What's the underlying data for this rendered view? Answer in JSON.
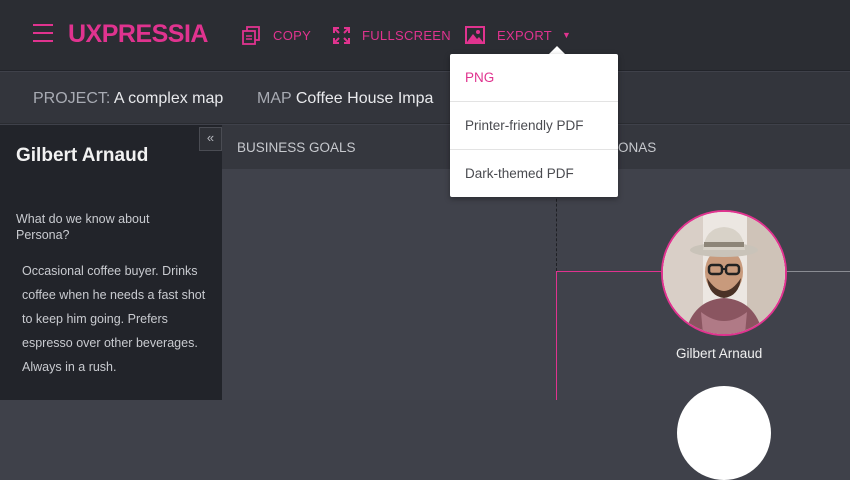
{
  "app": {
    "logo": "UXPRESSIA",
    "brand_color": "#e0338f"
  },
  "toolbar": {
    "copy_label": "COPY",
    "fullscreen_label": "FULLSCREEN",
    "export_label": "EXPORT",
    "icons": [
      "hamburger-icon",
      "copy-icon",
      "fullscreen-icon",
      "image-icon",
      "caret-down-icon"
    ]
  },
  "export_menu": {
    "items": [
      {
        "label": "PNG",
        "selected": true
      },
      {
        "label": "Printer-friendly PDF",
        "selected": false
      },
      {
        "label": "Dark-themed PDF",
        "selected": false
      }
    ]
  },
  "project_bar": {
    "project_label": "PROJECT:",
    "project_name": "A complex map",
    "map_label": "MAP",
    "map_name": "Coffee House Impa"
  },
  "sidebar": {
    "persona_name": "Gilbert Arnaud",
    "question": "What do we know about Persona?",
    "answer": "Occasional coffee buyer. Drinks coffee when he needs a fast shot to keep him going. Prefers espresso over other beverages. Always in a rush.",
    "collapse_symbol": "«"
  },
  "columns": {
    "business_goals": "BUSINESS GOALS",
    "personas_partial": "ONAS"
  },
  "persona_card": {
    "name": "Gilbert Arnaud"
  }
}
